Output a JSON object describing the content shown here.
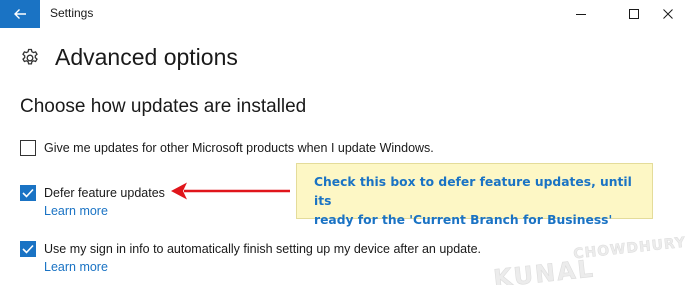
{
  "window": {
    "title": "Settings",
    "icons": {
      "back": "back-arrow-icon",
      "minimize": "minimize-icon",
      "maximize": "maximize-icon",
      "close": "close-icon"
    }
  },
  "page": {
    "title": "Advanced options",
    "icon": "gear-icon",
    "section_title": "Choose how updates are installed"
  },
  "options": [
    {
      "label": "Give me updates for other Microsoft products when I update Windows.",
      "checked": false
    },
    {
      "label": "Defer feature updates",
      "checked": true,
      "link": "Learn more"
    },
    {
      "label": "Use my sign in info to automatically finish setting up my device after an update.",
      "checked": true,
      "link": "Learn more"
    }
  ],
  "callout": {
    "line1": "Check this box to defer feature updates, until its",
    "line2": "ready for the 'Current Branch for Business'"
  },
  "watermark": {
    "word1": "KUNAL",
    "word2": "CHOWDHURY"
  },
  "colors": {
    "accent": "#1a73c4",
    "arrow": "#e0151b",
    "callout_bg": "#fdf7c5"
  }
}
